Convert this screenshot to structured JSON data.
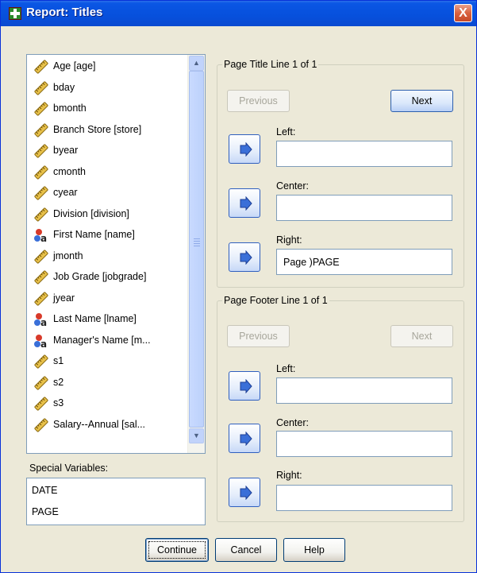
{
  "window": {
    "title": "Report: Titles",
    "close_glyph": "X"
  },
  "variables": [
    {
      "label": "Age [age]",
      "icon": "scale-ruler-icon"
    },
    {
      "label": "bday",
      "icon": "scale-ruler-icon"
    },
    {
      "label": "bmonth",
      "icon": "scale-ruler-icon"
    },
    {
      "label": "Branch Store [store]",
      "icon": "scale-ruler-icon"
    },
    {
      "label": "byear",
      "icon": "scale-ruler-icon"
    },
    {
      "label": "cmonth",
      "icon": "scale-ruler-icon"
    },
    {
      "label": "cyear",
      "icon": "scale-ruler-icon"
    },
    {
      "label": "Division [division]",
      "icon": "scale-ruler-icon"
    },
    {
      "label": "First Name [name]",
      "icon": "nominal-string-icon"
    },
    {
      "label": "jmonth",
      "icon": "scale-ruler-icon"
    },
    {
      "label": "Job Grade [jobgrade]",
      "icon": "scale-ruler-icon"
    },
    {
      "label": "jyear",
      "icon": "scale-ruler-icon"
    },
    {
      "label": "Last Name [lname]",
      "icon": "nominal-string-icon"
    },
    {
      "label": "Manager's Name [m...",
      "icon": "nominal-string-icon"
    },
    {
      "label": "s1",
      "icon": "scale-ruler-icon"
    },
    {
      "label": "s2",
      "icon": "scale-ruler-icon"
    },
    {
      "label": "s3",
      "icon": "scale-ruler-icon"
    },
    {
      "label": "Salary--Annual [sal...",
      "icon": "scale-ruler-icon"
    }
  ],
  "special": {
    "label": "Special Variables:",
    "items": [
      "DATE",
      "PAGE"
    ]
  },
  "title_group": {
    "legend": "Page Title Line 1 of 1",
    "previous": "Previous",
    "next": "Next",
    "left_label": "Left:",
    "left_value": "",
    "center_label": "Center:",
    "center_value": "",
    "right_label": "Right:",
    "right_value": "Page )PAGE"
  },
  "footer_group": {
    "legend": "Page Footer Line 1 of 1",
    "previous": "Previous",
    "next": "Next",
    "left_label": "Left:",
    "left_value": "",
    "center_label": "Center:",
    "center_value": "",
    "right_label": "Right:",
    "right_value": ""
  },
  "buttons": {
    "continue": "Continue",
    "cancel": "Cancel",
    "help": "Help"
  },
  "colors": {
    "titlebar": "#0a56e4",
    "dialog_bg": "#ece9d8",
    "accent_blue": "#2f5fbf"
  }
}
